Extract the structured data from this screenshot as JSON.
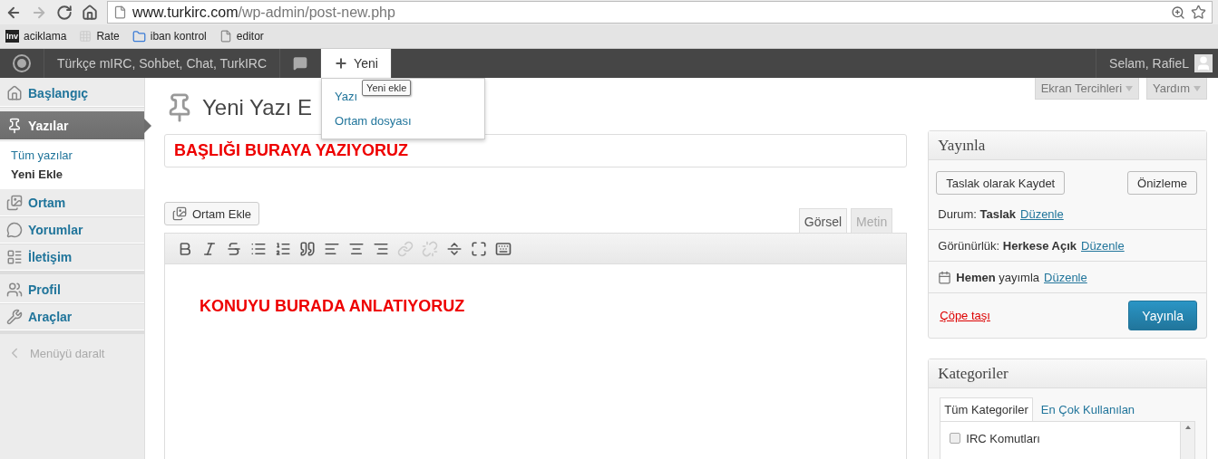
{
  "browser": {
    "nav": [
      {
        "kind": "back",
        "disabled": false
      },
      {
        "kind": "forward",
        "disabled": true
      },
      {
        "kind": "reload",
        "disabled": false
      },
      {
        "kind": "home",
        "disabled": false
      }
    ],
    "url_host": "www.turkirc.com",
    "url_path": "/wp-admin/post-new.php",
    "bookmarks": [
      {
        "kind": "logo",
        "logo_text": "Inv",
        "label": "aciklama"
      },
      {
        "kind": "grid",
        "label": "Rate"
      },
      {
        "kind": "folder",
        "label": "iban kontrol"
      },
      {
        "kind": "page",
        "label": "editor"
      }
    ]
  },
  "admin_bar": {
    "site_name": "Türkçe mIRC, Sohbet, Chat, TurkIRC",
    "new_label": "Yeni",
    "new_open": true,
    "new_menu": [
      "Yazı",
      "Ortam dosyası"
    ],
    "tooltip": "Yeni ekle",
    "greeting": "Selam, RafieL"
  },
  "sidebar": {
    "groups": [
      [
        {
          "kind": "home",
          "label": "Başlangıç",
          "selected": false
        },
        {
          "kind": "pin",
          "label": "Yazılar",
          "selected": true,
          "children": [
            {
              "label": "Tüm yazılar",
              "selected": false
            },
            {
              "label": "Yeni Ekle",
              "selected": true
            }
          ]
        },
        {
          "kind": "media",
          "label": "Ortam",
          "selected": false
        },
        {
          "kind": "comments",
          "label": "Yorumlar",
          "selected": false
        },
        {
          "kind": "form",
          "label": "İletişim",
          "selected": false
        }
      ],
      [
        {
          "kind": "users",
          "label": "Profil",
          "selected": false
        },
        {
          "kind": "tools",
          "label": "Araçlar",
          "selected": false
        }
      ]
    ],
    "collapse": "Menüyü daralt"
  },
  "screen_tabs": [
    "Ekran Tercihleri",
    "Yardım"
  ],
  "page_title": "Yeni Yazı E",
  "title_field": {
    "value": "BAŞLIĞI BURAYA YAZIYORUZ"
  },
  "media_button": "Ortam Ekle",
  "editor_tabs": [
    {
      "label": "Görsel",
      "selected": true
    },
    {
      "label": "Metin",
      "selected": false
    }
  ],
  "toolbar": [
    {
      "kind": "bold",
      "disabled": false
    },
    {
      "kind": "italic",
      "disabled": false
    },
    {
      "kind": "strike",
      "disabled": false
    },
    {
      "kind": "bullets",
      "disabled": false
    },
    {
      "kind": "numbers",
      "disabled": false
    },
    {
      "kind": "quote",
      "disabled": false
    },
    {
      "kind": "align_left",
      "disabled": false
    },
    {
      "kind": "align_center",
      "disabled": false
    },
    {
      "kind": "align_right",
      "disabled": false
    },
    {
      "kind": "link",
      "disabled": true
    },
    {
      "kind": "unlink",
      "disabled": true
    },
    {
      "kind": "more",
      "disabled": false
    },
    {
      "kind": "fullscreen",
      "disabled": false
    },
    {
      "kind": "kitchen_sink",
      "disabled": false
    }
  ],
  "editor_content": "KONUYU BURADA ANLATIYORUZ",
  "publish": {
    "title": "Yayınla",
    "save_button": "Taslak olarak Kaydet",
    "preview_button": "Önizleme",
    "rows": [
      {
        "kind": "plain",
        "text": "Durum: **Taslak**",
        "link": "Düzenle"
      },
      {
        "kind": "plain",
        "text": "Görünürlük: **Herkese Açık**",
        "link": "Düzenle"
      },
      {
        "kind": "schedule",
        "text": "**Hemen** yayımla",
        "link": "Düzenle"
      }
    ],
    "trash_link": "Çöpe taşı",
    "publish_button": "Yayınla"
  },
  "categories": {
    "title": "Kategoriler",
    "tabs": [
      {
        "label": "Tüm Kategoriler",
        "selected": true
      },
      {
        "label": "En Çok Kullanılan",
        "selected": false
      }
    ],
    "items": [
      {
        "label": "IRC Komutları",
        "checked": false
      }
    ]
  }
}
